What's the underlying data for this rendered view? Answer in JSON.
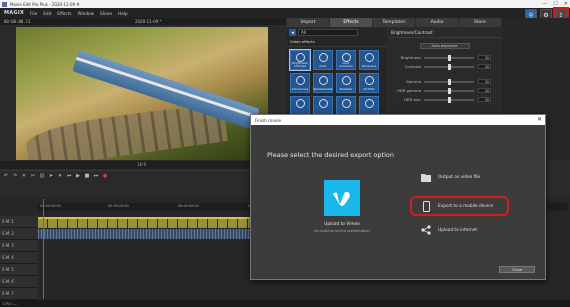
{
  "window": {
    "title": "Movie Edit Pro Plus - 2020-11-09 #",
    "min": "—",
    "max": "☐",
    "close": "✕"
  },
  "menu": {
    "logo": "MAGIX",
    "items": [
      "File",
      "Edit",
      "Effects",
      "Window",
      "Share",
      "Help"
    ]
  },
  "preview": {
    "timecode": "00:00:00.11",
    "date": "2020-11-09 *",
    "zoom": "16:9"
  },
  "panel_tabs": [
    "Import",
    "Effects",
    "Templates",
    "Audio",
    "Store"
  ],
  "active_tab": "Effects",
  "effects": {
    "filter": "All",
    "section": "Video effects",
    "items": [
      {
        "label": "Brightness/ Contrast"
      },
      {
        "label": "Color"
      },
      {
        "label": "Color correction"
      },
      {
        "label": "Sharpness"
      },
      {
        "label": "Chroma key"
      },
      {
        "label": "Reinterpolate"
      },
      {
        "label": "Stabilizer"
      },
      {
        "label": "Art filter"
      },
      {
        "label": ""
      },
      {
        "label": ""
      },
      {
        "label": ""
      },
      {
        "label": ""
      }
    ]
  },
  "brightness_panel": {
    "title": "Brightness/Contrast",
    "auto_button": "Auto exposure",
    "sliders": [
      {
        "label": "Brightness",
        "value": "50"
      },
      {
        "label": "Contrast",
        "value": "50"
      },
      {
        "label": "Gamma",
        "value": "50"
      },
      {
        "label": "HDR gamma",
        "value": "50"
      },
      {
        "label": "HDR blur",
        "value": "50"
      }
    ]
  },
  "timeline": {
    "ruler_labels": [
      "00:00:00:00",
      "00:00:20:00",
      "00:00:40:00",
      "00:01:00:00",
      "00:01:20:00",
      "00:01:40:00"
    ],
    "tracks": [
      "1",
      "2",
      "3",
      "4",
      "5",
      "6",
      "7",
      "8"
    ]
  },
  "status": {
    "text": "CPU: —"
  },
  "dialog": {
    "title": "Finish movie",
    "close": "✕",
    "heading": "Please select the desired export option",
    "vimeo_label": "Upload to Vimeo",
    "vimeo_sub": "for optimal online presentation",
    "options": [
      {
        "label": "Output as video file"
      },
      {
        "label": "Export to a mobile device"
      },
      {
        "label": "Upload to internet"
      }
    ],
    "close_button": "Close"
  }
}
